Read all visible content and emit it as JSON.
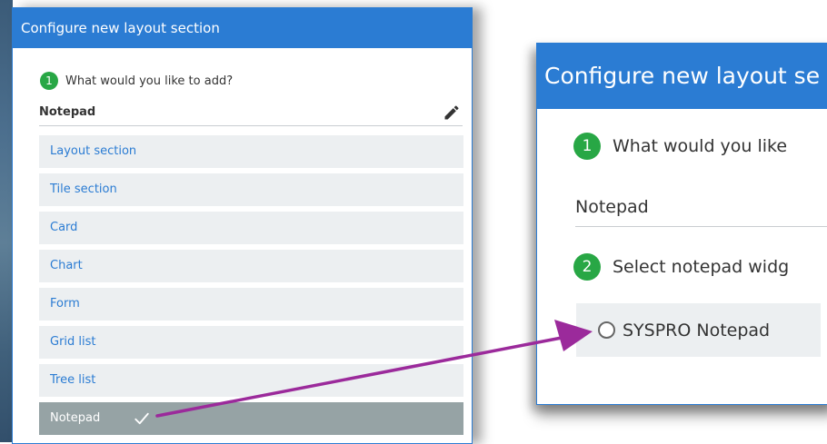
{
  "left_dialog": {
    "title": "Configure new layout section",
    "step1": {
      "number": "1",
      "question": "What would you like to add?"
    },
    "field": {
      "value": "Notepad",
      "edit_icon": "pencil-icon"
    },
    "options": [
      {
        "label": "Layout section",
        "selected": false
      },
      {
        "label": "Tile section",
        "selected": false
      },
      {
        "label": "Card",
        "selected": false
      },
      {
        "label": "Chart",
        "selected": false
      },
      {
        "label": "Form",
        "selected": false
      },
      {
        "label": "Grid list",
        "selected": false
      },
      {
        "label": "Tree list",
        "selected": false
      },
      {
        "label": "Notepad",
        "selected": true
      }
    ],
    "selected_icon": "checkmark-icon"
  },
  "right_dialog": {
    "title": "Configure new layout se",
    "step1": {
      "number": "1",
      "question": "What would you like"
    },
    "field": {
      "value": "Notepad"
    },
    "step2": {
      "number": "2",
      "question": "Select notepad widg"
    },
    "radio": {
      "label": "SYSPRO Notepad",
      "checked": false
    }
  },
  "colors": {
    "header": "#2b7cd3",
    "step_badge": "#28a745",
    "option_bg": "#eceff1",
    "option_text": "#2b7cd3",
    "selected_bg": "#96a3a5",
    "arrow": "#9b2a9b"
  }
}
